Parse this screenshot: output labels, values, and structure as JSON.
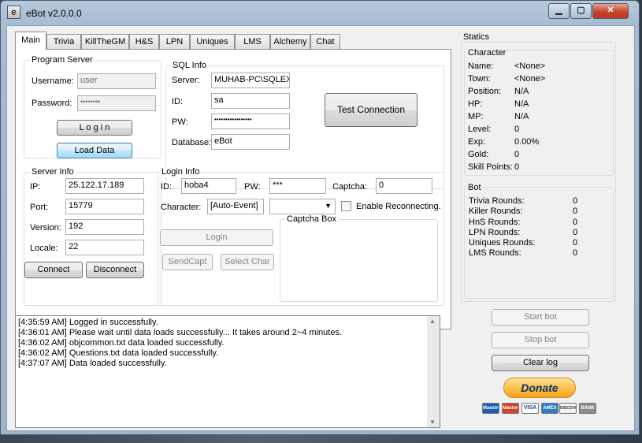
{
  "window": {
    "title": "eBot v2.0.0.0",
    "icon": "e"
  },
  "tabs": [
    "Main",
    "Trivia",
    "KillTheGM",
    "H&S",
    "LPN",
    "Uniques",
    "LMS",
    "Alchemy",
    "Chat"
  ],
  "program_server": {
    "title": "Program Server",
    "username_label": "Username:",
    "username_value": "user",
    "password_label": "Password:",
    "password_value": "••••••••",
    "login_button": "L o g i n",
    "load_data_button": "Load Data"
  },
  "sql_info": {
    "title": "SQL Info",
    "server_label": "Server:",
    "server_value": "MUHAB-PC\\SQLEX",
    "id_label": "ID:",
    "id_value": "sa",
    "pw_label": "PW:",
    "pw_value": "•••••••••••••••••",
    "database_label": "Database:",
    "database_value": "eBot",
    "test_button": "Test Connection"
  },
  "server_info": {
    "title": "Server Info",
    "ip_label": "IP:",
    "ip_value": "25.122.17.189",
    "port_label": "Port:",
    "port_value": "15779",
    "version_label": "Version:",
    "version_value": "192",
    "locale_label": "Locale:",
    "locale_value": "22",
    "connect_button": "Connect",
    "disconnect_button": "Disconnect"
  },
  "login_info": {
    "title": "Login Info",
    "id_label": "ID:",
    "id_value": "hoba4",
    "pw_label": "PW:",
    "pw_value": "***",
    "captcha_label": "Captcha:",
    "captcha_value": "0",
    "character_label": "Character:",
    "character_value": "[Auto-Event]",
    "reconnect_label": "Enable Reconnecting.",
    "login_button": "Login",
    "sendcapt_button": "SendCapt",
    "select_char_button": "Select Char",
    "captcha_box_title": "Captcha Box"
  },
  "log": [
    "[4:35:59 AM] Logged in successfully.",
    "[4:36:01 AM] Please wait until data loads successfully... It takes around 2~4 minutes.",
    "[4:36:02 AM] objcommon.txt data loaded successfully.",
    "[4:36:02 AM] Questions.txt data loaded successfully.",
    "[4:37:07 AM] Data loaded successfully."
  ],
  "statics": {
    "title": "Statics",
    "character_title": "Character",
    "character": [
      {
        "label": "Name:",
        "value": "<None>"
      },
      {
        "label": "Town:",
        "value": "<None>"
      },
      {
        "label": "Position:",
        "value": "N/A"
      },
      {
        "label": "HP:",
        "value": "N/A"
      },
      {
        "label": "MP:",
        "value": "N/A"
      },
      {
        "label": "Level:",
        "value": "0"
      },
      {
        "label": "Exp:",
        "value": "0.00%"
      },
      {
        "label": "Gold:",
        "value": "0"
      },
      {
        "label": "Skill Points:",
        "value": "0"
      }
    ],
    "bot_title": "Bot",
    "bot": [
      {
        "label": "Trivia Rounds:",
        "value": "0"
      },
      {
        "label": "Killer Rounds:",
        "value": "0"
      },
      {
        "label": "HnS Rounds:",
        "value": "0"
      },
      {
        "label": "LPN Rounds:",
        "value": "0"
      },
      {
        "label": "Uniques Rounds:",
        "value": "0"
      },
      {
        "label": "LMS Rounds:",
        "value": "0"
      }
    ]
  },
  "controls": {
    "start_bot": "Start bot",
    "stop_bot": "Stop bot",
    "clear_log": "Clear log",
    "donate": "Donate"
  },
  "cards": [
    "Maestro",
    "MasterCard",
    "VISA",
    "AMEX",
    "DISCOVER",
    "BANK"
  ]
}
